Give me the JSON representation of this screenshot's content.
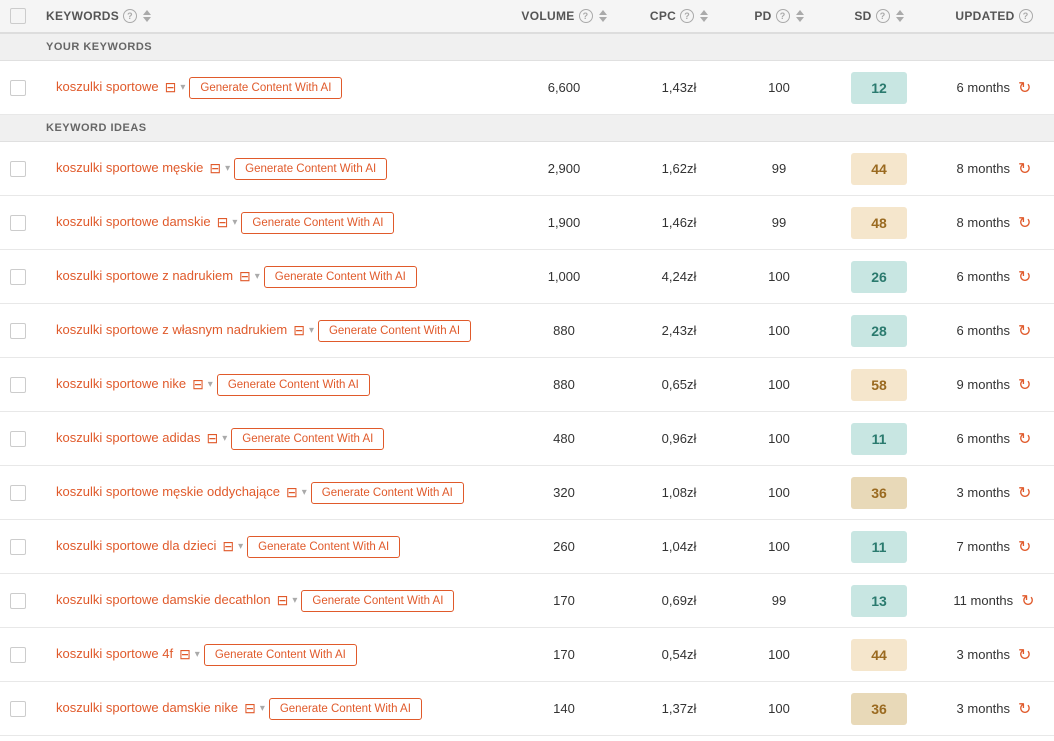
{
  "header": {
    "select_all_label": "",
    "keywords_label": "KEYWORDS",
    "volume_label": "VOLUME",
    "cpc_label": "CPC",
    "pd_label": "PD",
    "sd_label": "SD",
    "updated_label": "UPDATED",
    "generate_btn_label": "Generate Content With AI"
  },
  "sections": [
    {
      "id": "your-keywords",
      "label": "YOUR KEYWORDS",
      "rows": [
        {
          "id": "row-1",
          "keyword": "koszulki sportowe",
          "volume": "6,600",
          "cpc": "1,43zł",
          "pd": "100",
          "sd": "12",
          "sd_color": "#c8e6e2",
          "sd_text_color": "#2a7a6e",
          "updated": "6 months"
        }
      ]
    },
    {
      "id": "keyword-ideas",
      "label": "KEYWORD IDEAS",
      "rows": [
        {
          "id": "row-2",
          "keyword": "koszulki sportowe męskie",
          "volume": "2,900",
          "cpc": "1,62zł",
          "pd": "99",
          "sd": "44",
          "sd_color": "#f5e6cc",
          "sd_text_color": "#9a6a20",
          "updated": "8 months"
        },
        {
          "id": "row-3",
          "keyword": "koszulki sportowe damskie",
          "volume": "1,900",
          "cpc": "1,46zł",
          "pd": "99",
          "sd": "48",
          "sd_color": "#f5e6cc",
          "sd_text_color": "#9a6a20",
          "updated": "8 months"
        },
        {
          "id": "row-4",
          "keyword": "koszulki sportowe z nadrukiem",
          "volume": "1,000",
          "cpc": "4,24zł",
          "pd": "100",
          "sd": "26",
          "sd_color": "#c8e6e2",
          "sd_text_color": "#2a7a6e",
          "updated": "6 months"
        },
        {
          "id": "row-5",
          "keyword": "koszulki sportowe z własnym nadrukiem",
          "volume": "880",
          "cpc": "2,43zł",
          "pd": "100",
          "sd": "28",
          "sd_color": "#c8e6e2",
          "sd_text_color": "#2a7a6e",
          "updated": "6 months"
        },
        {
          "id": "row-6",
          "keyword": "koszulki sportowe nike",
          "volume": "880",
          "cpc": "0,65zł",
          "pd": "100",
          "sd": "58",
          "sd_color": "#f5e6cc",
          "sd_text_color": "#9a6a20",
          "updated": "9 months"
        },
        {
          "id": "row-7",
          "keyword": "koszulki sportowe adidas",
          "volume": "480",
          "cpc": "0,96zł",
          "pd": "100",
          "sd": "11",
          "sd_color": "#c8e6e2",
          "sd_text_color": "#2a7a6e",
          "updated": "6 months"
        },
        {
          "id": "row-8",
          "keyword": "koszulki sportowe męskie oddychające",
          "volume": "320",
          "cpc": "1,08zł",
          "pd": "100",
          "sd": "36",
          "sd_color": "#e8d9b8",
          "sd_text_color": "#9a6a20",
          "updated": "3 months"
        },
        {
          "id": "row-9",
          "keyword": "koszulki sportowe dla dzieci",
          "volume": "260",
          "cpc": "1,04zł",
          "pd": "100",
          "sd": "11",
          "sd_color": "#c8e6e2",
          "sd_text_color": "#2a7a6e",
          "updated": "7 months"
        },
        {
          "id": "row-10",
          "keyword": "koszulki sportowe damskie decathlon",
          "volume": "170",
          "cpc": "0,69zł",
          "pd": "99",
          "sd": "13",
          "sd_color": "#c8e6e2",
          "sd_text_color": "#2a7a6e",
          "updated": "11 months"
        },
        {
          "id": "row-11",
          "keyword": "koszulki sportowe 4f",
          "volume": "170",
          "cpc": "0,54zł",
          "pd": "100",
          "sd": "44",
          "sd_color": "#f5e6cc",
          "sd_text_color": "#9a6a20",
          "updated": "3 months"
        },
        {
          "id": "row-12",
          "keyword": "koszulki sportowe damskie nike",
          "volume": "140",
          "cpc": "1,37zł",
          "pd": "100",
          "sd": "36",
          "sd_color": "#e8d9b8",
          "sd_text_color": "#9a6a20",
          "updated": "3 months"
        }
      ]
    }
  ]
}
